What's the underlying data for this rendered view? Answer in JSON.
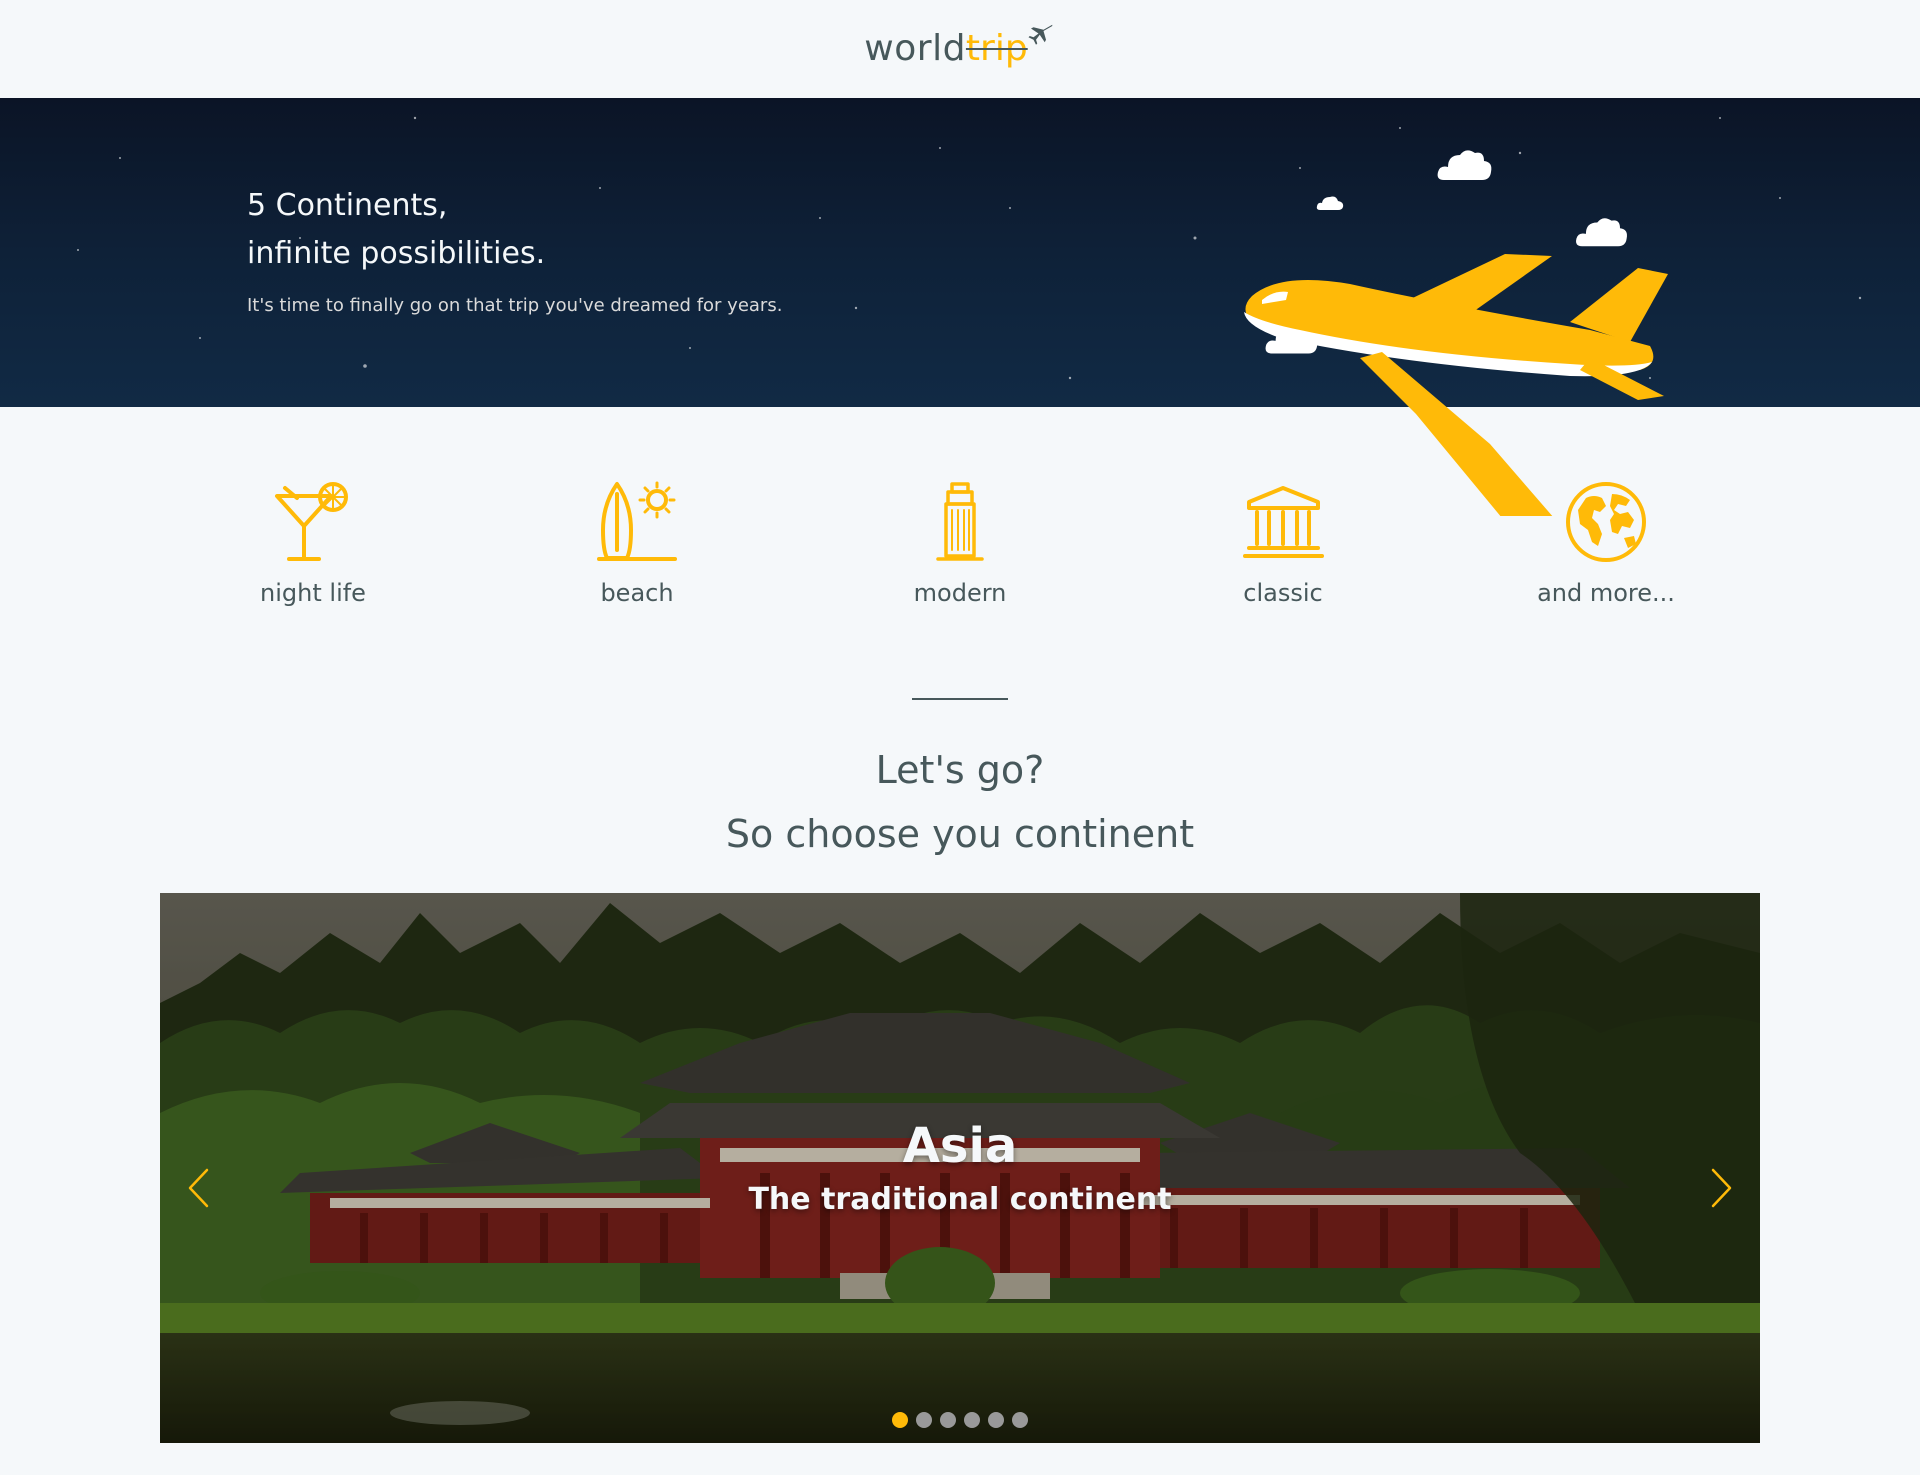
{
  "header": {
    "logo_world": "world",
    "logo_trip": "trip",
    "logo_icon": "airplane-icon"
  },
  "banner": {
    "title_line1": "5 Continents,",
    "title_line2": "infinite possibilities.",
    "subtitle": "It's time to finally go on that trip you've dreamed for years.",
    "illustration": "airplane-with-clouds"
  },
  "categories": [
    {
      "label": "night life",
      "icon": "cocktail-icon"
    },
    {
      "label": "beach",
      "icon": "surfboard-sun-icon"
    },
    {
      "label": "modern",
      "icon": "skyscraper-icon"
    },
    {
      "label": "classic",
      "icon": "museum-icon"
    },
    {
      "label": "and more...",
      "icon": "globe-icon"
    }
  ],
  "cta": {
    "line1": "Let's go?",
    "line2": "So choose you continent"
  },
  "carousel": {
    "active_index": 0,
    "slide": {
      "title": "Asia",
      "subtitle": "The traditional continent",
      "image": "japanese-temple-photo"
    },
    "slide_count": 6
  },
  "colors": {
    "accent": "#ffba08",
    "text": "#47585b",
    "background": "#f5f8fa",
    "banner": "#0e2138"
  }
}
